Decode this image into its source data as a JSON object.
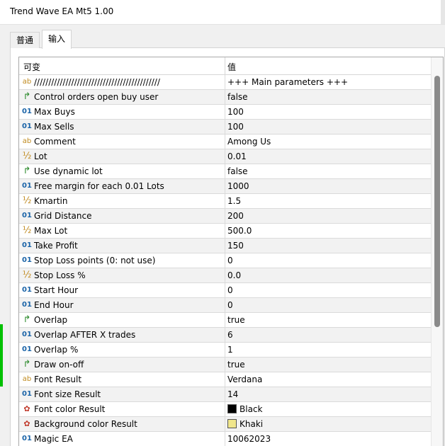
{
  "window": {
    "title": "Trend Wave EA Mt5 1.00"
  },
  "tabs": [
    {
      "label": "普通",
      "active": false
    },
    {
      "label": "输入",
      "active": true
    }
  ],
  "table": {
    "columns": [
      "可变",
      "值"
    ],
    "rows": [
      {
        "type": "str",
        "name": "////////////////////////////////////////////",
        "value": "+++ Main parameters +++"
      },
      {
        "type": "bool",
        "name": "Control orders open buy user",
        "value": "false"
      },
      {
        "type": "int",
        "name": "Max Buys",
        "value": "100"
      },
      {
        "type": "int",
        "name": "Max Sells",
        "value": "100"
      },
      {
        "type": "str",
        "name": "Comment",
        "value": "Among Us"
      },
      {
        "type": "dbl",
        "name": "Lot",
        "value": "0.01"
      },
      {
        "type": "bool",
        "name": "Use dynamic lot",
        "value": "false"
      },
      {
        "type": "int",
        "name": "Free margin for each 0.01 Lots",
        "value": "1000"
      },
      {
        "type": "dbl",
        "name": "Kmartin",
        "value": "1.5"
      },
      {
        "type": "int",
        "name": "Grid Distance",
        "value": "200"
      },
      {
        "type": "dbl",
        "name": "Max Lot",
        "value": "500.0"
      },
      {
        "type": "int",
        "name": "Take Profit",
        "value": "150"
      },
      {
        "type": "int",
        "name": "Stop Loss points  (0: not use)",
        "value": "0"
      },
      {
        "type": "dbl",
        "name": "Stop Loss %",
        "value": "0.0"
      },
      {
        "type": "int",
        "name": "Start Hour",
        "value": "0"
      },
      {
        "type": "int",
        "name": "End Hour",
        "value": "0"
      },
      {
        "type": "bool",
        "name": "Overlap",
        "value": "true"
      },
      {
        "type": "int",
        "name": "Overlap AFTER X trades",
        "value": "6"
      },
      {
        "type": "int",
        "name": "Overlap %",
        "value": "1"
      },
      {
        "type": "bool",
        "name": "Draw on-off",
        "value": "true"
      },
      {
        "type": "str",
        "name": "Font Result",
        "value": "Verdana"
      },
      {
        "type": "int",
        "name": "Font size Result",
        "value": "14"
      },
      {
        "type": "color",
        "name": "Font color Result",
        "value": "Black",
        "swatch": "#000000"
      },
      {
        "type": "color",
        "name": "Background color Result",
        "value": "Khaki",
        "swatch": "#f0e68c"
      },
      {
        "type": "int",
        "name": "Magic EA",
        "value": "10062023"
      }
    ]
  },
  "icons": {
    "int": "01",
    "str": "ab",
    "dbl": "½",
    "bool": "↱",
    "color": "✿"
  }
}
